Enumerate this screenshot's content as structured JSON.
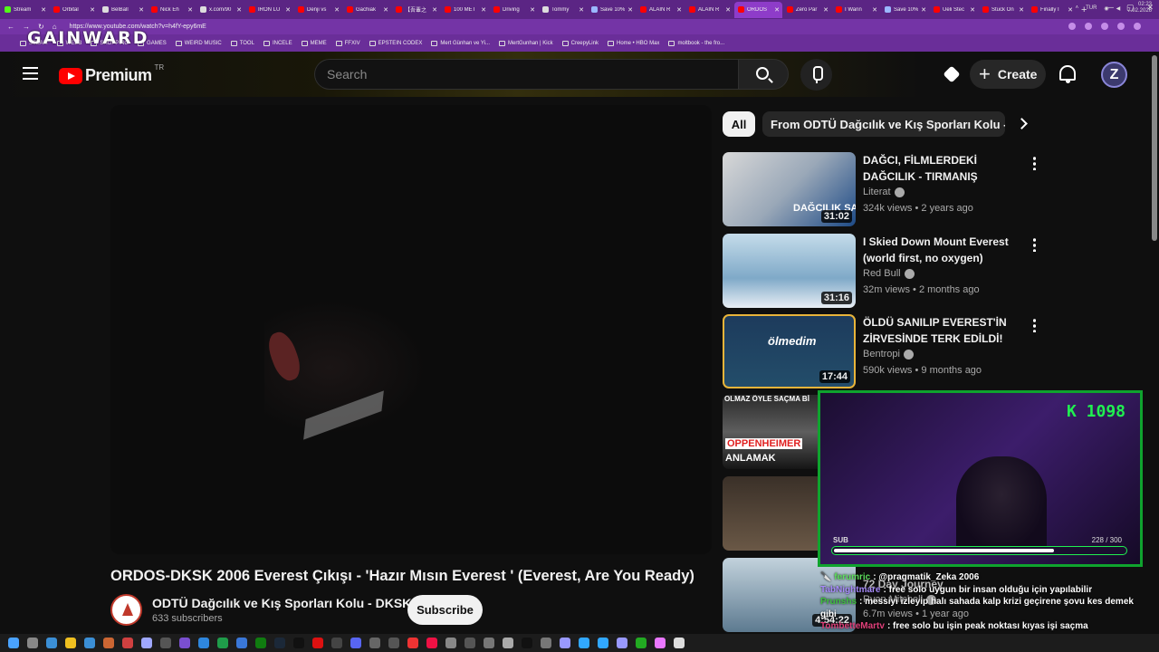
{
  "browser": {
    "tabs": [
      {
        "label": "Stream",
        "color": "#53fc18"
      },
      {
        "label": "Orbital",
        "color": "#ff0000"
      },
      {
        "label": "BelBall",
        "color": "#dddddd"
      },
      {
        "label": "Nick Eh",
        "color": "#ff0000"
      },
      {
        "label": "x.com/90",
        "color": "#dddddd"
      },
      {
        "label": "IRON LU",
        "color": "#ff0000"
      },
      {
        "label": "Denji vs",
        "color": "#ff0000"
      },
      {
        "label": "Gachiak",
        "color": "#ff0000"
      },
      {
        "label": "【吾輩之",
        "color": "#ff0000"
      },
      {
        "label": "100 MET",
        "color": "#ff0000"
      },
      {
        "label": "Driving",
        "color": "#ff0000"
      },
      {
        "label": "Tommy",
        "color": "#dddddd"
      },
      {
        "label": "Save 10%",
        "color": "#9bb8ff"
      },
      {
        "label": "ALAIN R",
        "color": "#ff0000"
      },
      {
        "label": "ALAIN R",
        "color": "#ff0000"
      },
      {
        "label": "ORDOS",
        "color": "#ff0000",
        "active": true
      },
      {
        "label": "Zero Par",
        "color": "#ff0000"
      },
      {
        "label": "I Wann",
        "color": "#ff0000"
      },
      {
        "label": "Save 10%",
        "color": "#9bb8ff"
      },
      {
        "label": "Ueli Stec",
        "color": "#ff0000"
      },
      {
        "label": "Stuck On",
        "color": "#ff0000"
      },
      {
        "label": "Finally I",
        "color": "#ff0000"
      }
    ],
    "new_tab": "+",
    "url": "https://www.youtube.com/watch?v=h4fY-epy6mE",
    "bookmarks": [
      "STEAM",
      "WEEB",
      "SHOPPING",
      "GAMES",
      "WEIRD MUSIC",
      "TOOL",
      "INCELE",
      "MEME",
      "FFXIV",
      "EPSTEIN CODEX",
      "Mert Günhan ve Yi...",
      "MertGunhan | Kick",
      "CreepyLink",
      "Home • HBO Max",
      "moltbook - the fro..."
    ],
    "overlay_logo": "GAINWARD"
  },
  "header": {
    "logo_text": "Premium",
    "region": "TR",
    "search_placeholder": "Search",
    "create_label": "Create",
    "avatar_letter": "Z"
  },
  "video": {
    "title": "ORDOS-DKSK 2006 Everest Çıkışı - 'Hazır Mısın Everest ' (Everest, Are You Ready)",
    "channel": "ODTÜ Dağcılık ve Kış Sporları Kolu - DKSK",
    "subscribers": "633 subscribers",
    "subscribe_label": "Subscribe"
  },
  "chips": {
    "all": "All",
    "from": "From ODTÜ Dağcılık ve Kış Sporları Kolu - DKSK"
  },
  "recommendations": [
    {
      "title": "DAĞCI, FİLMLERDEKİ DAĞCILIK - TIRMANIŞ SAHNELERİNİ ...",
      "channel": "Literat",
      "views": "324k views",
      "age": "2 years ago",
      "duration": "31:02",
      "thumb_text": "DAĞCILIK SAHNE"
    },
    {
      "title": "I Skied Down Mount Everest (world first, no oxygen)",
      "channel": "Red Bull",
      "views": "32m views",
      "age": "2 months ago",
      "duration": "31:16",
      "thumb_text": ""
    },
    {
      "title": "ÖLDÜ SANILIP EVEREST'İN ZİRVESİNDE TERK EDİLDİ!",
      "channel": "Bentropi",
      "views": "590k views",
      "age": "9 months ago",
      "duration": "17:44",
      "thumb_text": "ölmedim"
    },
    {
      "title": "",
      "channel": "",
      "views": "",
      "age": "",
      "duration": "",
      "thumb_text": "OLMAZ ÖYLE SAÇMA Bİ",
      "thumb_text2": "OPPENHEIMER",
      "thumb_text3": "ANLAMAK"
    },
    {
      "title": "",
      "channel": "",
      "views": "",
      "age": "",
      "duration": "",
      "thumb_text": ""
    },
    {
      "title": "72 Day Journey",
      "channel": "Ryan Mitchell",
      "views": "6.7m views",
      "age": "1 year ago",
      "duration": "4:54:22",
      "thumb_text": ""
    }
  ],
  "stream_overlay": {
    "kick_count": "K 1098",
    "sub_label": "SUB",
    "sub_count": "228  / 300",
    "sub_progress": 0.76
  },
  "chat": [
    {
      "user": "🔪 ferumric",
      "color": "#5ee05e",
      "message": ": @pragmatik_Zeka 2006"
    },
    {
      "user": "TabNightmare",
      "color": "#a78bfa",
      "message": ": free solo uygun bir insan olduğu için yapılabilir"
    },
    {
      "user": "Prunshs",
      "color": "#40c040",
      "message": ": messiyi izleyip halı sahada kalp krizi geçirene şovu kes demek gibi"
    },
    {
      "user": "TombetteMartv",
      "color": "#e0407a",
      "message": ": free solo bu işin peak noktası kıyas işi saçma"
    }
  ],
  "taskbar": {
    "lang": "TUR",
    "time": "02:23",
    "date": "7.02.2026",
    "icons": [
      "#4aa3ff",
      "#888",
      "#3b8fd6",
      "#f0c020",
      "#3b8fd6",
      "#cc6633",
      "#d04040",
      "#9fa8ff",
      "#555",
      "#7a4fd0",
      "#2e86de",
      "#1f9c4a",
      "#3a77d8",
      "#107c10",
      "#1b2838",
      "#111",
      "#d11",
      "#444",
      "#5865f2",
      "#666",
      "#555",
      "#e33",
      "#e14",
      "#888",
      "#555",
      "#777",
      "#aaa",
      "#111",
      "#777",
      "#9999ff",
      "#31a8ff",
      "#31a8ff",
      "#9999ff",
      "#2a2",
      "#ea77ff",
      "#ddd"
    ]
  }
}
